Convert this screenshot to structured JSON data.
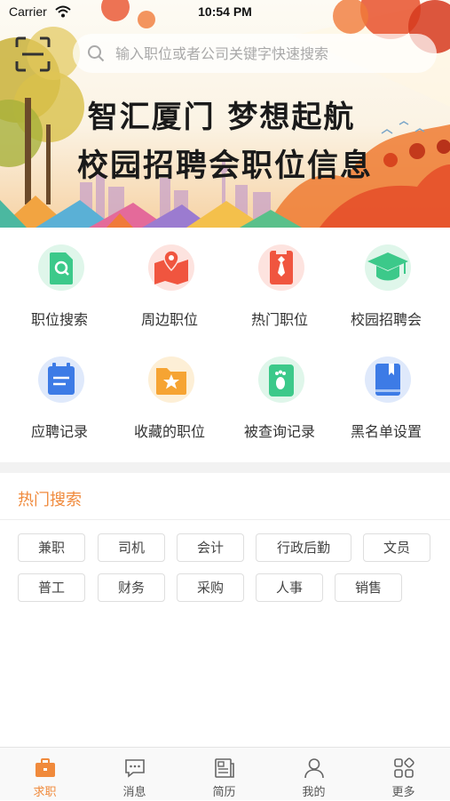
{
  "status_bar": {
    "carrier": "Carrier",
    "time": "10:54 PM"
  },
  "search": {
    "placeholder": "输入职位或者公司关键字快速搜索",
    "value": ""
  },
  "banner": {
    "line1": "智汇厦门  梦想起航",
    "line2": "校园招聘会职位信息"
  },
  "menu": [
    {
      "label": "职位搜索",
      "icon": "job-search-icon",
      "color": "#3cc98a"
    },
    {
      "label": "周边职位",
      "icon": "nearby-map-icon",
      "color": "#f0553f"
    },
    {
      "label": "热门职位",
      "icon": "hot-job-tie-icon",
      "color": "#f0553f"
    },
    {
      "label": "校园招聘会",
      "icon": "graduation-cap-icon",
      "color": "#3cc98a"
    },
    {
      "label": "应聘记录",
      "icon": "application-record-icon",
      "color": "#3d7be6"
    },
    {
      "label": "收藏的职位",
      "icon": "favorite-folder-icon",
      "color": "#f6a433"
    },
    {
      "label": "被查询记录",
      "icon": "footprint-icon",
      "color": "#3cc98a"
    },
    {
      "label": "黑名单设置",
      "icon": "blacklist-book-icon",
      "color": "#3d7be6"
    }
  ],
  "hot_search": {
    "title": "热门搜索",
    "tags": [
      "兼职",
      "司机",
      "会计",
      "行政后勤",
      "文员",
      "普工",
      "财务",
      "采购",
      "人事",
      "销售"
    ]
  },
  "tabbar": {
    "active": 0,
    "accent": "#f08a3c",
    "tabs": [
      {
        "label": "求职",
        "icon": "briefcase-icon"
      },
      {
        "label": "消息",
        "icon": "message-icon"
      },
      {
        "label": "简历",
        "icon": "resume-icon"
      },
      {
        "label": "我的",
        "icon": "user-icon"
      },
      {
        "label": "更多",
        "icon": "more-grid-icon"
      }
    ]
  }
}
